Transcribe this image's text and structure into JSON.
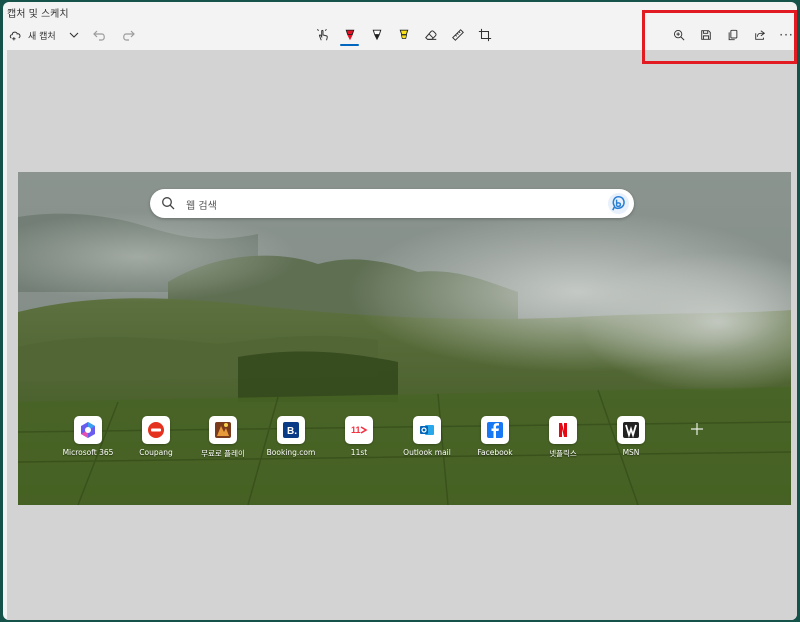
{
  "window": {
    "title": "캡처 및 스케치"
  },
  "toolbar": {
    "new_capture_label": "새 캡처",
    "left_icons": [
      "new-capture-icon",
      "chevron-down-icon",
      "undo-icon",
      "redo-icon"
    ],
    "center_tools": [
      "touch-writing-icon",
      "ballpoint-pen-icon",
      "pencil-icon",
      "highlighter-icon",
      "eraser-icon",
      "ruler-icon",
      "crop-icon"
    ],
    "selected_tool": "ballpoint-pen-icon",
    "right_icons": [
      "zoom-icon",
      "save-icon",
      "copy-icon",
      "share-icon"
    ],
    "more_label": "···"
  },
  "colors": {
    "accent": "#0067c0",
    "highlight_border": "#e21b22",
    "pen_red": "#e81123",
    "highlighter_yellow": "#f7e11a",
    "canvas_bg": "#d3d3d3",
    "frame": "#14524a"
  },
  "browser": {
    "search_placeholder": "웹 검색",
    "tiles": [
      {
        "label": "Microsoft 365",
        "icon": "microsoft-365-icon"
      },
      {
        "label": "Coupang",
        "icon": "coupang-icon"
      },
      {
        "label": "무료로 플레이",
        "icon": "game-icon"
      },
      {
        "label": "Booking.com",
        "icon": "booking-icon"
      },
      {
        "label": "11st",
        "icon": "11st-icon"
      },
      {
        "label": "Outlook mail",
        "icon": "outlook-icon"
      },
      {
        "label": "Facebook",
        "icon": "facebook-icon"
      },
      {
        "label": "넷플릭스",
        "icon": "netflix-icon"
      },
      {
        "label": "MSN",
        "icon": "msn-icon"
      }
    ],
    "add_icon": "plus-icon"
  }
}
